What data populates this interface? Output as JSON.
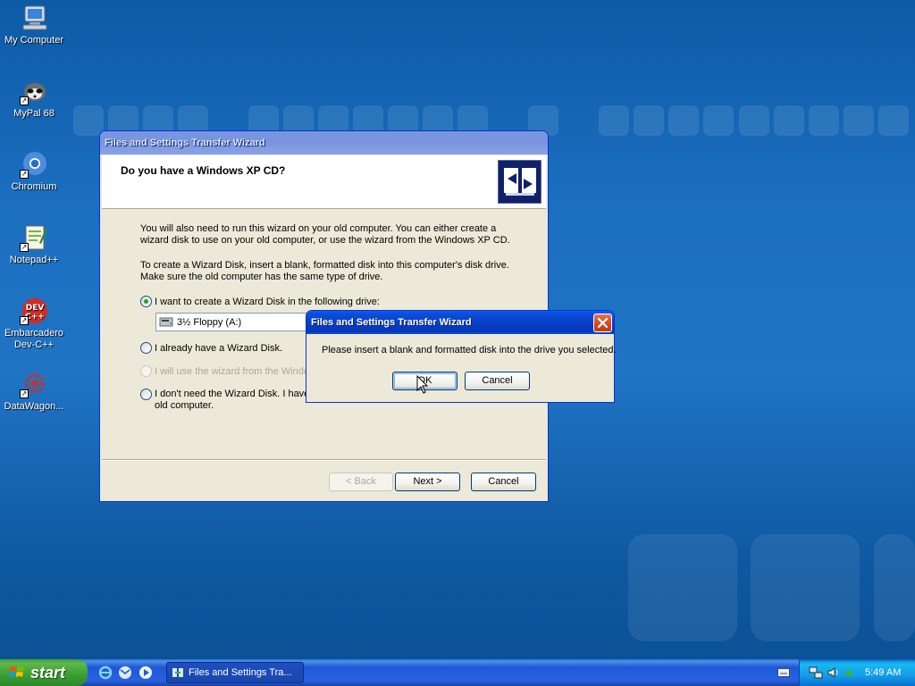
{
  "desktop": {
    "icons": [
      {
        "label": "My Computer"
      },
      {
        "label": "MyPal 68"
      },
      {
        "label": "Chromium"
      },
      {
        "label": "Notepad++"
      },
      {
        "label": "Embarcadero Dev-C++"
      },
      {
        "label": "DataWagon..."
      }
    ]
  },
  "wizard": {
    "title": "Files and Settings Transfer Wizard",
    "heading": "Do you have a Windows XP CD?",
    "para1_line1": "You will also need to run this wizard on your old computer. You can either create a",
    "para1_line2": "wizard disk to use on your old computer, or use the wizard from the Windows XP CD.",
    "para2_line1": "To create a Wizard Disk, insert a blank, formatted disk into this computer's disk drive.",
    "para2_line2": "Make sure the old computer has the same type of drive.",
    "options": [
      {
        "label": "I want to create a Wizard Disk in the following drive:",
        "checked": true,
        "enabled": true
      },
      {
        "label": "I already have a Wizard Disk.",
        "checked": false,
        "enabled": true
      },
      {
        "label": "I will use the wizard from the Windows",
        "checked": false,
        "enabled": false
      },
      {
        "label": "I don't need the Wizard Disk. I have",
        "label_line2": "old computer.",
        "checked": false,
        "enabled": true
      }
    ],
    "drive_select_value": "3½ Floppy (A:)",
    "back_label": "< Back",
    "next_label": "Next >",
    "cancel_label": "Cancel"
  },
  "dialog": {
    "title": "Files and Settings Transfer Wizard",
    "message": "Please insert a blank and formatted disk into the drive you selected.",
    "ok_label": "OK",
    "cancel_label": "Cancel"
  },
  "taskbar": {
    "start_label": "start",
    "task_label": "Files and Settings Tra...",
    "clock": "5:49 AM"
  },
  "colors": {
    "title_active": "#0a3fc8",
    "dialog_face": "#ece9d8",
    "start_green": "#3a9c32"
  }
}
